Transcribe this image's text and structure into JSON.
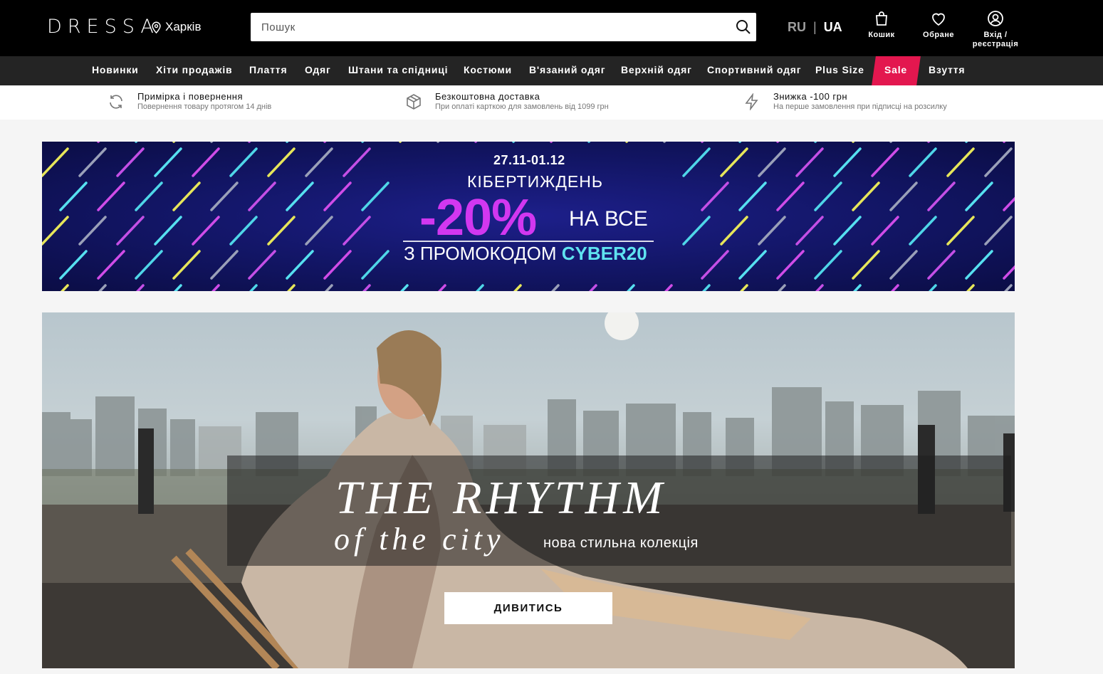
{
  "header": {
    "logo": "DRESSA",
    "city": "Харків",
    "search": {
      "placeholder": "Пошук",
      "value": ""
    },
    "lang": {
      "ru": "RU",
      "separator": "|",
      "ua": "UA",
      "active": "UA"
    },
    "cart_label": "Кошик",
    "favorites_label": "Обране",
    "login_label_line1": "Вхід /",
    "login_label_line2": "реєстрація"
  },
  "nav": {
    "items": [
      {
        "label": "Новинки"
      },
      {
        "label": "Хіти продажів"
      },
      {
        "label": "Плаття"
      },
      {
        "label": "Одяг"
      },
      {
        "label": "Штани та спідниці"
      },
      {
        "label": "Костюми"
      },
      {
        "label": "В'язаний одяг"
      },
      {
        "label": "Верхній одяг"
      },
      {
        "label": "Спортивний одяг"
      },
      {
        "label": "Plus Size"
      },
      {
        "label": "Sale"
      },
      {
        "label": "Взуття"
      }
    ],
    "sale_color": "#e3174f"
  },
  "benefits": [
    {
      "icon": "refresh-icon",
      "title": "Примірка і повернення",
      "subtitle": "Повернення товару протягом 14 днів"
    },
    {
      "icon": "box-icon",
      "title": "Безкоштовна доставка",
      "subtitle": "При оплаті карткою для замовлень від 1099 грн"
    },
    {
      "icon": "lightning-icon",
      "title": "Знижка -100 грн",
      "subtitle": "На перше замовлення при підписці на розсилку"
    }
  ],
  "promo": {
    "dates": "27.11-01.12",
    "title": "КІБЕРТИЖДЕНЬ",
    "discount": "-20%",
    "discount_suffix": "НА ВСЕ",
    "code_prefix": "З ПРОМОКОДОМ",
    "code": "CYBER20",
    "accent_color": "#d237f0",
    "code_color": "#5fe3f0"
  },
  "hero": {
    "title": "THE RHYTHM",
    "subtitle": "of the city",
    "caption": "нова стильна колекція",
    "button_label": "ДИВИТИСЬ"
  }
}
